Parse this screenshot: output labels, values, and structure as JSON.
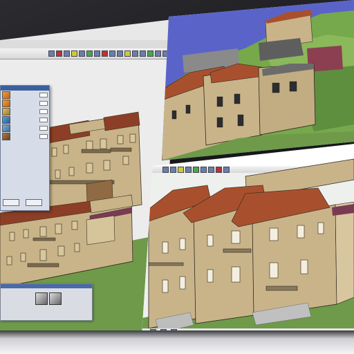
{
  "app": {
    "left_window": {
      "dialog": {
        "title": "",
        "rows": [
          {
            "label": "",
            "value": ""
          },
          {
            "label": "",
            "value": ""
          },
          {
            "label": "",
            "value": ""
          },
          {
            "label": "",
            "value": ""
          },
          {
            "label": "",
            "value": ""
          },
          {
            "label": "",
            "value": ""
          }
        ],
        "ok_label": "",
        "cancel_label": ""
      },
      "properties_panel": {
        "label": ""
      }
    },
    "right_top_window": {},
    "right_bottom_window": {
      "status_text": ""
    }
  },
  "colors": {
    "wall": "#c9b48a",
    "roof": "#a8502e",
    "grass": "#6e9a4a",
    "sky_blue": "#5a64c8",
    "dialog_title": "#3b5f9f"
  }
}
